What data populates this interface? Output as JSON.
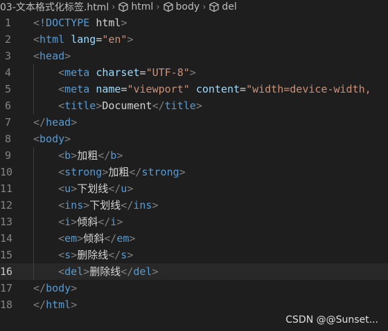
{
  "breadcrumb": {
    "file": "03-文本格式化标签.html",
    "items": [
      "html",
      "body",
      "del"
    ]
  },
  "editor": {
    "active_line": 16,
    "lines": [
      {
        "n": "1",
        "tokens": [
          [
            "p",
            "<"
          ],
          [
            "d",
            "!DOCTYPE"
          ],
          [
            "t",
            " "
          ],
          [
            "t",
            "html"
          ],
          [
            "p",
            ">"
          ]
        ]
      },
      {
        "n": "2",
        "tokens": [
          [
            "p",
            "<"
          ],
          [
            "g",
            "html"
          ],
          [
            "t",
            " "
          ],
          [
            "a",
            "lang"
          ],
          [
            "t",
            "="
          ],
          [
            "s",
            "\"en\""
          ],
          [
            "p",
            ">"
          ]
        ]
      },
      {
        "n": "3",
        "tokens": [
          [
            "p",
            "<"
          ],
          [
            "g",
            "head"
          ],
          [
            "p",
            ">"
          ]
        ]
      },
      {
        "n": "4",
        "tokens": [
          [
            "t",
            "    "
          ],
          [
            "p",
            "<"
          ],
          [
            "g",
            "meta"
          ],
          [
            "t",
            " "
          ],
          [
            "a",
            "charset"
          ],
          [
            "t",
            "="
          ],
          [
            "s",
            "\"UTF-8\""
          ],
          [
            "p",
            ">"
          ]
        ]
      },
      {
        "n": "5",
        "tokens": [
          [
            "t",
            "    "
          ],
          [
            "p",
            "<"
          ],
          [
            "g",
            "meta"
          ],
          [
            "t",
            " "
          ],
          [
            "a",
            "name"
          ],
          [
            "t",
            "="
          ],
          [
            "s",
            "\"viewport\""
          ],
          [
            "t",
            " "
          ],
          [
            "a",
            "content"
          ],
          [
            "t",
            "="
          ],
          [
            "s",
            "\"width=device-width,"
          ]
        ]
      },
      {
        "n": "6",
        "tokens": [
          [
            "t",
            "    "
          ],
          [
            "p",
            "<"
          ],
          [
            "g",
            "title"
          ],
          [
            "p",
            ">"
          ],
          [
            "t",
            "Document"
          ],
          [
            "p",
            "</"
          ],
          [
            "g",
            "title"
          ],
          [
            "p",
            ">"
          ]
        ]
      },
      {
        "n": "7",
        "tokens": [
          [
            "p",
            "</"
          ],
          [
            "g",
            "head"
          ],
          [
            "p",
            ">"
          ]
        ]
      },
      {
        "n": "8",
        "tokens": [
          [
            "p",
            "<"
          ],
          [
            "g",
            "body"
          ],
          [
            "p",
            ">"
          ]
        ]
      },
      {
        "n": "9",
        "tokens": [
          [
            "t",
            "    "
          ],
          [
            "p",
            "<"
          ],
          [
            "g",
            "b"
          ],
          [
            "p",
            ">"
          ],
          [
            "t",
            "加粗"
          ],
          [
            "p",
            "</"
          ],
          [
            "g",
            "b"
          ],
          [
            "p",
            ">"
          ]
        ]
      },
      {
        "n": "10",
        "tokens": [
          [
            "t",
            "    "
          ],
          [
            "p",
            "<"
          ],
          [
            "g",
            "strong"
          ],
          [
            "p",
            ">"
          ],
          [
            "t",
            "加粗"
          ],
          [
            "p",
            "</"
          ],
          [
            "g",
            "strong"
          ],
          [
            "p",
            ">"
          ]
        ]
      },
      {
        "n": "11",
        "tokens": [
          [
            "t",
            "    "
          ],
          [
            "p",
            "<"
          ],
          [
            "g",
            "u"
          ],
          [
            "p",
            ">"
          ],
          [
            "t",
            "下划线"
          ],
          [
            "p",
            "</"
          ],
          [
            "g",
            "u"
          ],
          [
            "p",
            ">"
          ]
        ]
      },
      {
        "n": "12",
        "tokens": [
          [
            "t",
            "    "
          ],
          [
            "p",
            "<"
          ],
          [
            "g",
            "ins"
          ],
          [
            "p",
            ">"
          ],
          [
            "t",
            "下划线"
          ],
          [
            "p",
            "</"
          ],
          [
            "g",
            "ins"
          ],
          [
            "p",
            ">"
          ]
        ]
      },
      {
        "n": "13",
        "tokens": [
          [
            "t",
            "    "
          ],
          [
            "p",
            "<"
          ],
          [
            "g",
            "i"
          ],
          [
            "p",
            ">"
          ],
          [
            "t",
            "倾斜"
          ],
          [
            "p",
            "</"
          ],
          [
            "g",
            "i"
          ],
          [
            "p",
            ">"
          ]
        ]
      },
      {
        "n": "14",
        "tokens": [
          [
            "t",
            "    "
          ],
          [
            "p",
            "<"
          ],
          [
            "g",
            "em"
          ],
          [
            "p",
            ">"
          ],
          [
            "t",
            "倾斜"
          ],
          [
            "p",
            "</"
          ],
          [
            "g",
            "em"
          ],
          [
            "p",
            ">"
          ]
        ]
      },
      {
        "n": "15",
        "tokens": [
          [
            "t",
            "    "
          ],
          [
            "p",
            "<"
          ],
          [
            "g",
            "s"
          ],
          [
            "p",
            ">"
          ],
          [
            "t",
            "删除线"
          ],
          [
            "p",
            "</"
          ],
          [
            "g",
            "s"
          ],
          [
            "p",
            ">"
          ]
        ]
      },
      {
        "n": "16",
        "tokens": [
          [
            "t",
            "    "
          ],
          [
            "p",
            "<"
          ],
          [
            "g",
            "del"
          ],
          [
            "p",
            ">"
          ],
          [
            "t",
            "删除线"
          ],
          [
            "p",
            "</"
          ],
          [
            "g",
            "del"
          ],
          [
            "p",
            ">"
          ]
        ]
      },
      {
        "n": "17",
        "tokens": [
          [
            "p",
            "</"
          ],
          [
            "g",
            "body"
          ],
          [
            "p",
            ">"
          ]
        ]
      },
      {
        "n": "18",
        "tokens": [
          [
            "p",
            "</"
          ],
          [
            "g",
            "html"
          ],
          [
            "p",
            ">"
          ]
        ]
      }
    ]
  },
  "watermark": "CSDN @@Sunset...",
  "colors": {
    "background": "#1e1e1e",
    "tag": "#569cd6",
    "attribute": "#9cdcfe",
    "string": "#ce9178",
    "punctuation": "#808080",
    "text": "#d4d4d4",
    "line_number": "#858585"
  }
}
